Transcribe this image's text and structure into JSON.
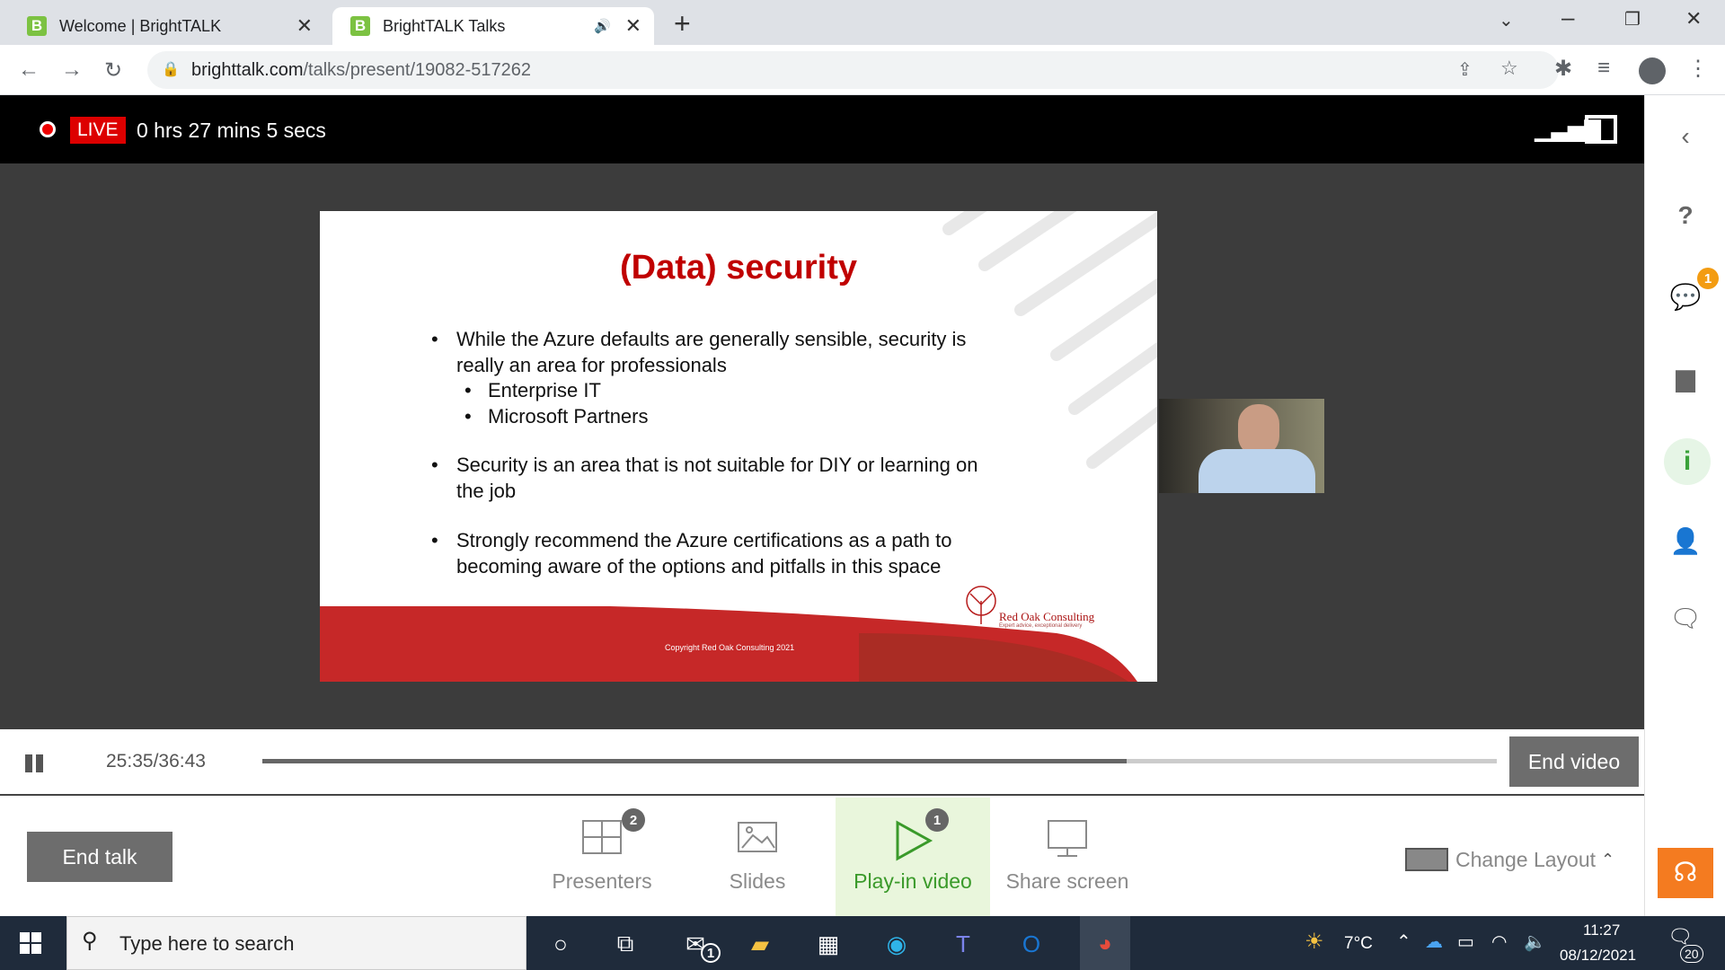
{
  "browser": {
    "tabs": [
      {
        "title": "Welcome | BrightTALK",
        "favicon": "B"
      },
      {
        "title": "BrightTALK Talks",
        "favicon": "B",
        "active": true
      }
    ],
    "url_domain": "brighttalk.com",
    "url_path": "/talks/present/19082-517262"
  },
  "player": {
    "live_label": "LIVE",
    "duration": "0 hrs 27 mins 5 secs"
  },
  "slide": {
    "title": "(Data) security",
    "bullets": [
      "While the Azure defaults are generally sensible, security is",
      "really an area for professionals",
      "Enterprise IT",
      "Microsoft Partners",
      "Security is an area that is not suitable for DIY or learning on",
      "the job",
      "Strongly recommend the Azure certifications as a path to",
      "becoming aware of the options and pitfalls in this space"
    ],
    "logo_text": "Red Oak Consulting",
    "logo_tagline": "Expert advice, exceptional delivery",
    "copyright": "Copyright Red Oak Consulting 2021"
  },
  "playback": {
    "current": "25:35",
    "total": "36:43",
    "progress_fraction": 0.7,
    "end_video_label": "End video"
  },
  "controls": {
    "end_talk_label": "End talk",
    "presenters_label": "Presenters",
    "presenters_count": "2",
    "slides_label": "Slides",
    "playin_label": "Play-in video",
    "playin_count": "1",
    "share_label": "Share screen",
    "change_layout_label": "Change Layout"
  },
  "rail": {
    "notifications_count": "1"
  },
  "taskbar": {
    "search_placeholder": "Type here to search",
    "mail_badge": "1",
    "weather": "7°C",
    "time": "11:27",
    "date": "08/12/2021",
    "notification_count": "20"
  }
}
